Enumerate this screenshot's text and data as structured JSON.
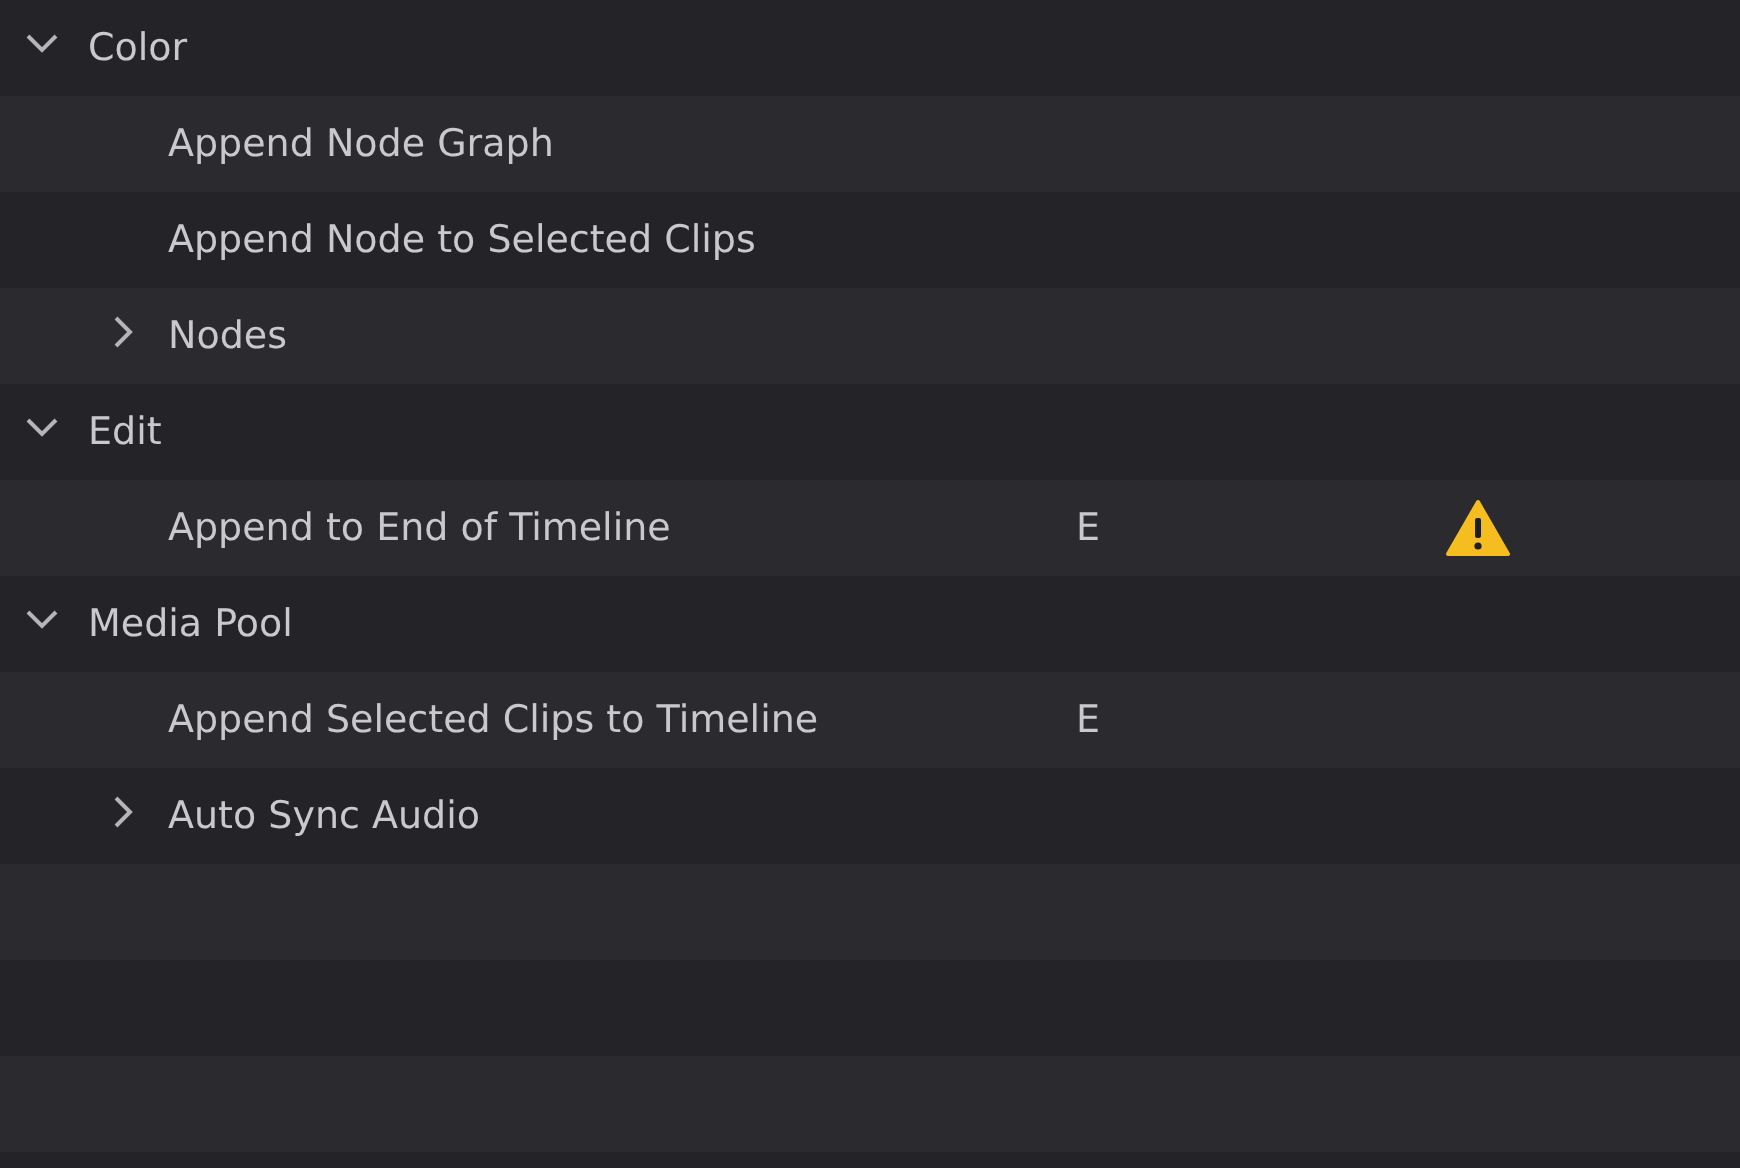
{
  "tree": [
    {
      "kind": "group",
      "label": "Color",
      "expanded": true,
      "children": [
        {
          "kind": "action",
          "label": "Append Node Graph",
          "warning": false
        },
        {
          "kind": "action",
          "label": "Append Node to Selected Clips",
          "warning": false
        },
        {
          "kind": "group",
          "label": "Nodes",
          "expanded": false
        }
      ]
    },
    {
      "kind": "group",
      "label": "Edit",
      "expanded": true,
      "children": [
        {
          "kind": "action",
          "label": "Append to End of Timeline",
          "shortcut": "E",
          "warning": true
        }
      ]
    },
    {
      "kind": "group",
      "label": "Media Pool",
      "expanded": true,
      "children": [
        {
          "kind": "action",
          "label": "Append Selected Clips to Timeline",
          "shortcut": "E",
          "warning": false
        },
        {
          "kind": "group",
          "label": "Auto Sync Audio",
          "expanded": false
        }
      ]
    }
  ]
}
